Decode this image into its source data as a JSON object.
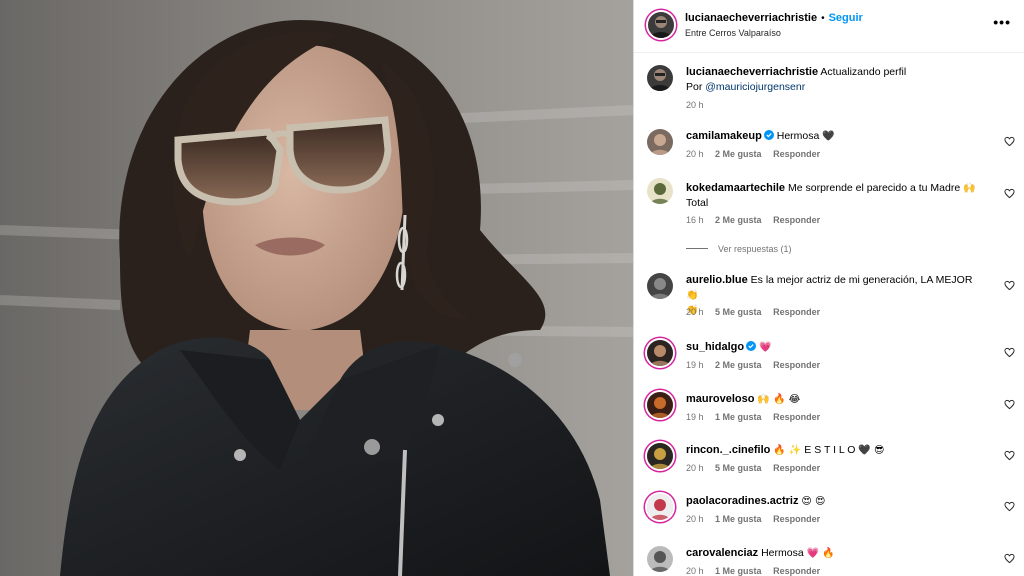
{
  "post": {
    "author": "lucianaecheverriachristie",
    "follow_label": "Seguir",
    "separator": "•",
    "location": "Entre Cerros Valparaíso",
    "more_label": "•••",
    "caption_text": "Actualizando perfil",
    "caption_credit_prefix": "Por",
    "caption_mention": "@mauriciojurgensenr",
    "caption_time": "20 h"
  },
  "comments": [
    {
      "username": "camilamakeup",
      "verified": true,
      "text": "Hermosa",
      "emoji": "🖤",
      "time": "20 h",
      "likes": "2 Me gusta",
      "reply": "Responder"
    },
    {
      "username": "kokedamaartechile",
      "verified": false,
      "text": "Me sorprende el parecido a tu Madre",
      "emoji": "🙌",
      "text2": "Total",
      "time": "16 h",
      "likes": "2 Me gusta",
      "reply": "Responder",
      "view_replies": "Ver respuestas (1)"
    },
    {
      "username": "aurelio.blue",
      "verified": false,
      "text": "Es la mejor actriz de mi generación, LA MEJOR",
      "emoji": "👏",
      "emoji2": "👏",
      "time": "20 h",
      "likes": "5 Me gusta",
      "reply": "Responder"
    },
    {
      "username": "su_hidalgo",
      "verified": true,
      "text": "",
      "emoji": "💗",
      "time": "19 h",
      "likes": "2 Me gusta",
      "reply": "Responder"
    },
    {
      "username": "mauroveloso",
      "verified": false,
      "text": "",
      "emoji": "🙌 🔥 😂",
      "time": "19 h",
      "likes": "1 Me gusta",
      "reply": "Responder"
    },
    {
      "username": "rincon._.cinefilo",
      "verified": false,
      "text": "E S T I L O",
      "emoji_pre": "🔥 ✨",
      "emoji": "🖤 😎",
      "time": "20 h",
      "likes": "5 Me gusta",
      "reply": "Responder"
    },
    {
      "username": "paolacoradines.actriz",
      "verified": false,
      "text": "",
      "emoji": "😍 😍",
      "time": "20 h",
      "likes": "1 Me gusta",
      "reply": "Responder"
    },
    {
      "username": "carovalenciaz",
      "verified": false,
      "text": "Hermosa",
      "emoji": "💗 🔥",
      "time": "20 h",
      "likes": "1 Me gusta",
      "reply": "Responder"
    }
  ],
  "colors": {
    "accent": "#0095f6",
    "mention": "#00376b",
    "muted": "#737373",
    "verified": "#0095f6"
  },
  "icons": {
    "like": "heart-outline-icon",
    "verified": "verified-badge-icon",
    "more": "more-horizontal-icon"
  }
}
